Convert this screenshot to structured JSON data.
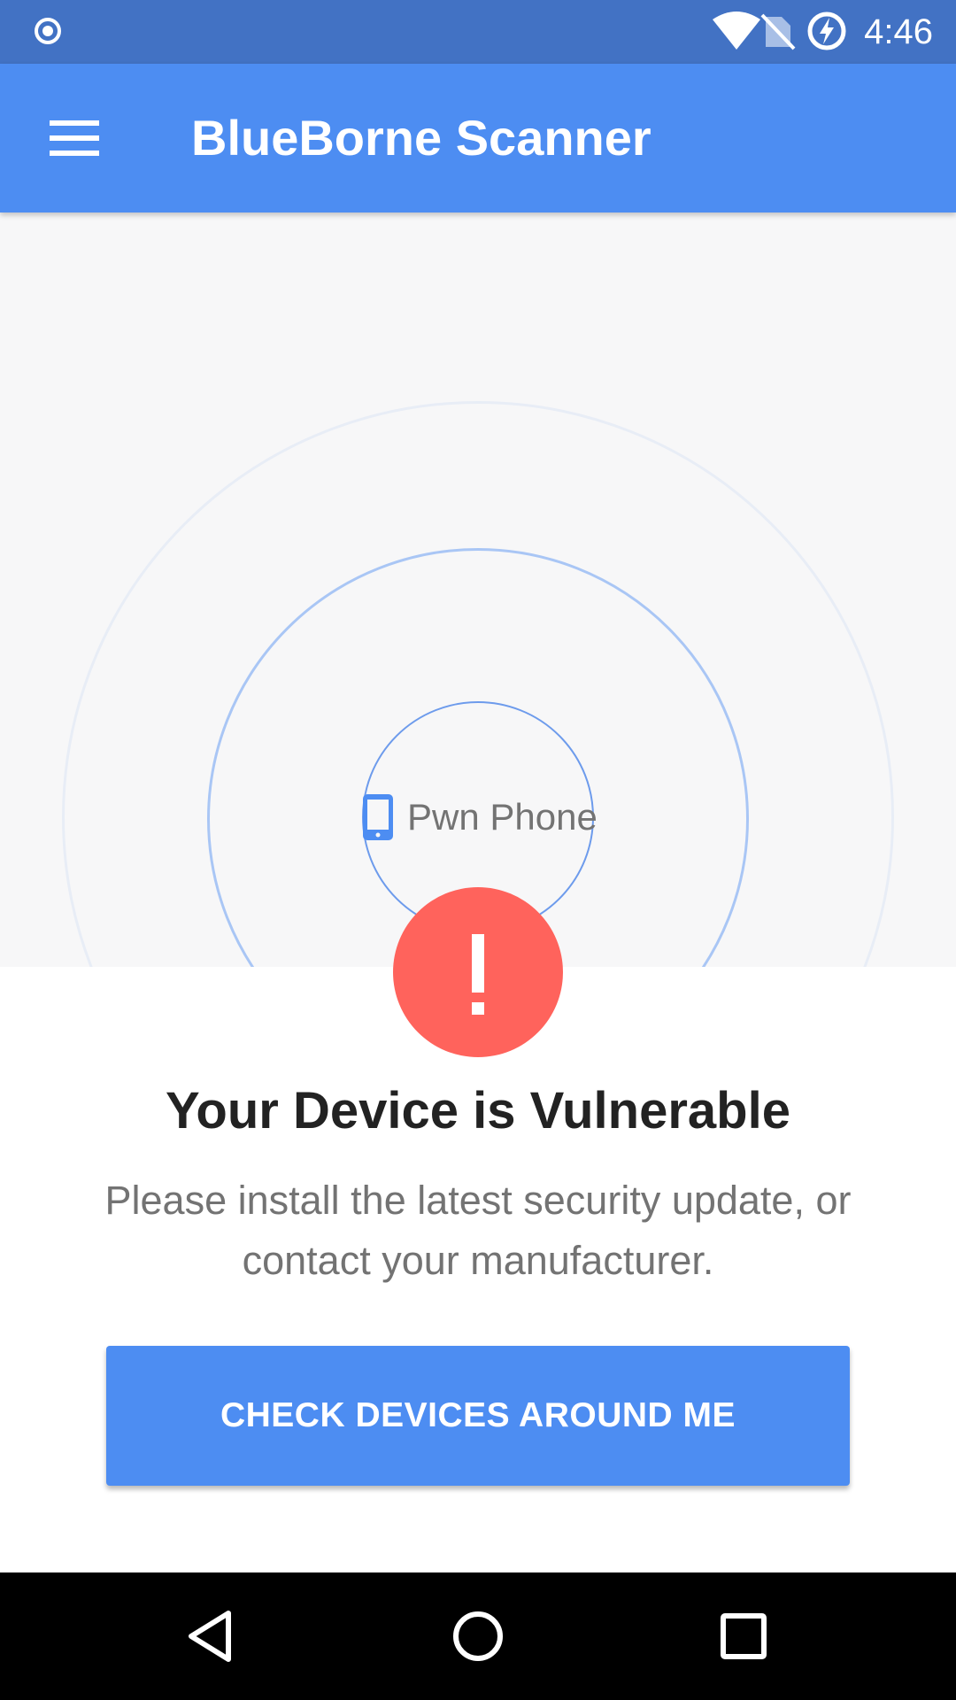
{
  "status_bar": {
    "time": "4:46",
    "icons": [
      "notification-target-icon",
      "wifi-icon",
      "no-sim-icon",
      "battery-charging-icon"
    ]
  },
  "app_bar": {
    "title": "BlueBorne Scanner",
    "menu_icon": "hamburger-menu-icon"
  },
  "radar": {
    "device_icon": "smartphone-icon",
    "device_name": "Pwn Phone"
  },
  "result": {
    "status_icon": "exclamation-icon",
    "title": "Your Device is Vulnerable",
    "message": "Please install the latest security update, or contact your manufacturer."
  },
  "actions": {
    "check_devices_label": "CHECK DEVICES AROUND ME"
  },
  "nav_bar": {
    "icons": [
      "back-icon",
      "home-icon",
      "recents-icon"
    ]
  },
  "colors": {
    "status_bar": "#4272c4",
    "app_bar": "#4d8df2",
    "accent": "#4d8df2",
    "alert": "#ff635c",
    "radar_background": "#f7f7f8"
  }
}
